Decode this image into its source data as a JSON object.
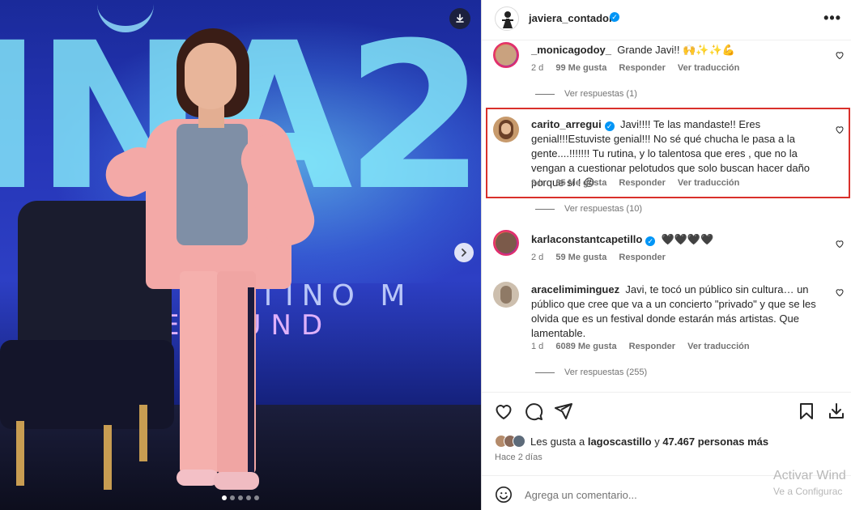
{
  "post": {
    "username": "javiera_contador",
    "more_label": "•••",
    "carousel_dots": 5,
    "active_dot": 1
  },
  "comments": [
    {
      "username": "_monicagodoy_",
      "verified": false,
      "text": "Grande Javi!! 🙌✨✨💪",
      "time": "2 d",
      "likes": "99 Me gusta",
      "reply": "Responder",
      "translate": "Ver traducción",
      "view_replies": "Ver respuestas (1)"
    },
    {
      "username": "carito_arregui",
      "verified": true,
      "text": "Javi!!!! Te las mandaste!! Eres genial!!!Estuviste genial!!! No sé qué chucha le pasa a la gente....!!!!!!! Tu rutina, y lo talentosa que eres , que no la vengan a cuestionar pelotudos que solo buscan hacer daño porque sí ! 😡",
      "time": "9 h",
      "likes": "85 Me gusta",
      "reply": "Responder",
      "translate": "Ver traducción",
      "view_replies": "Ver respuestas (10)"
    },
    {
      "username": "karlaconstantcapetillo",
      "verified": true,
      "text": "🖤🖤🖤🖤",
      "time": "2 d",
      "likes": "59 Me gusta",
      "reply": "Responder"
    },
    {
      "username": "aracelimiminguez",
      "verified": false,
      "text": "Javi, te tocó un público sin cultura… un público que cree que va a un concierto \"privado\" y que se les olvida que es un festival donde estarán más artistas. Que lamentable.",
      "time": "1 d",
      "likes": "6089 Me gusta",
      "reply": "Responder",
      "translate": "Ver traducción",
      "view_replies": "Ver respuestas (255)"
    }
  ],
  "actions": {
    "likes_prefix": "Les gusta a ",
    "likes_user": "lagoscastillo",
    "likes_mid": " y ",
    "likes_count": "47.467 personas más",
    "time_ago": "Hace 2 días",
    "comment_placeholder": "Agrega un comentario..."
  },
  "watermark": {
    "line1": "Activar Wind",
    "line2": "Ve a Configurac"
  },
  "colors": {
    "accent_blue": "#0095f6",
    "highlight_red": "#d9302a",
    "muted": "#737373"
  }
}
